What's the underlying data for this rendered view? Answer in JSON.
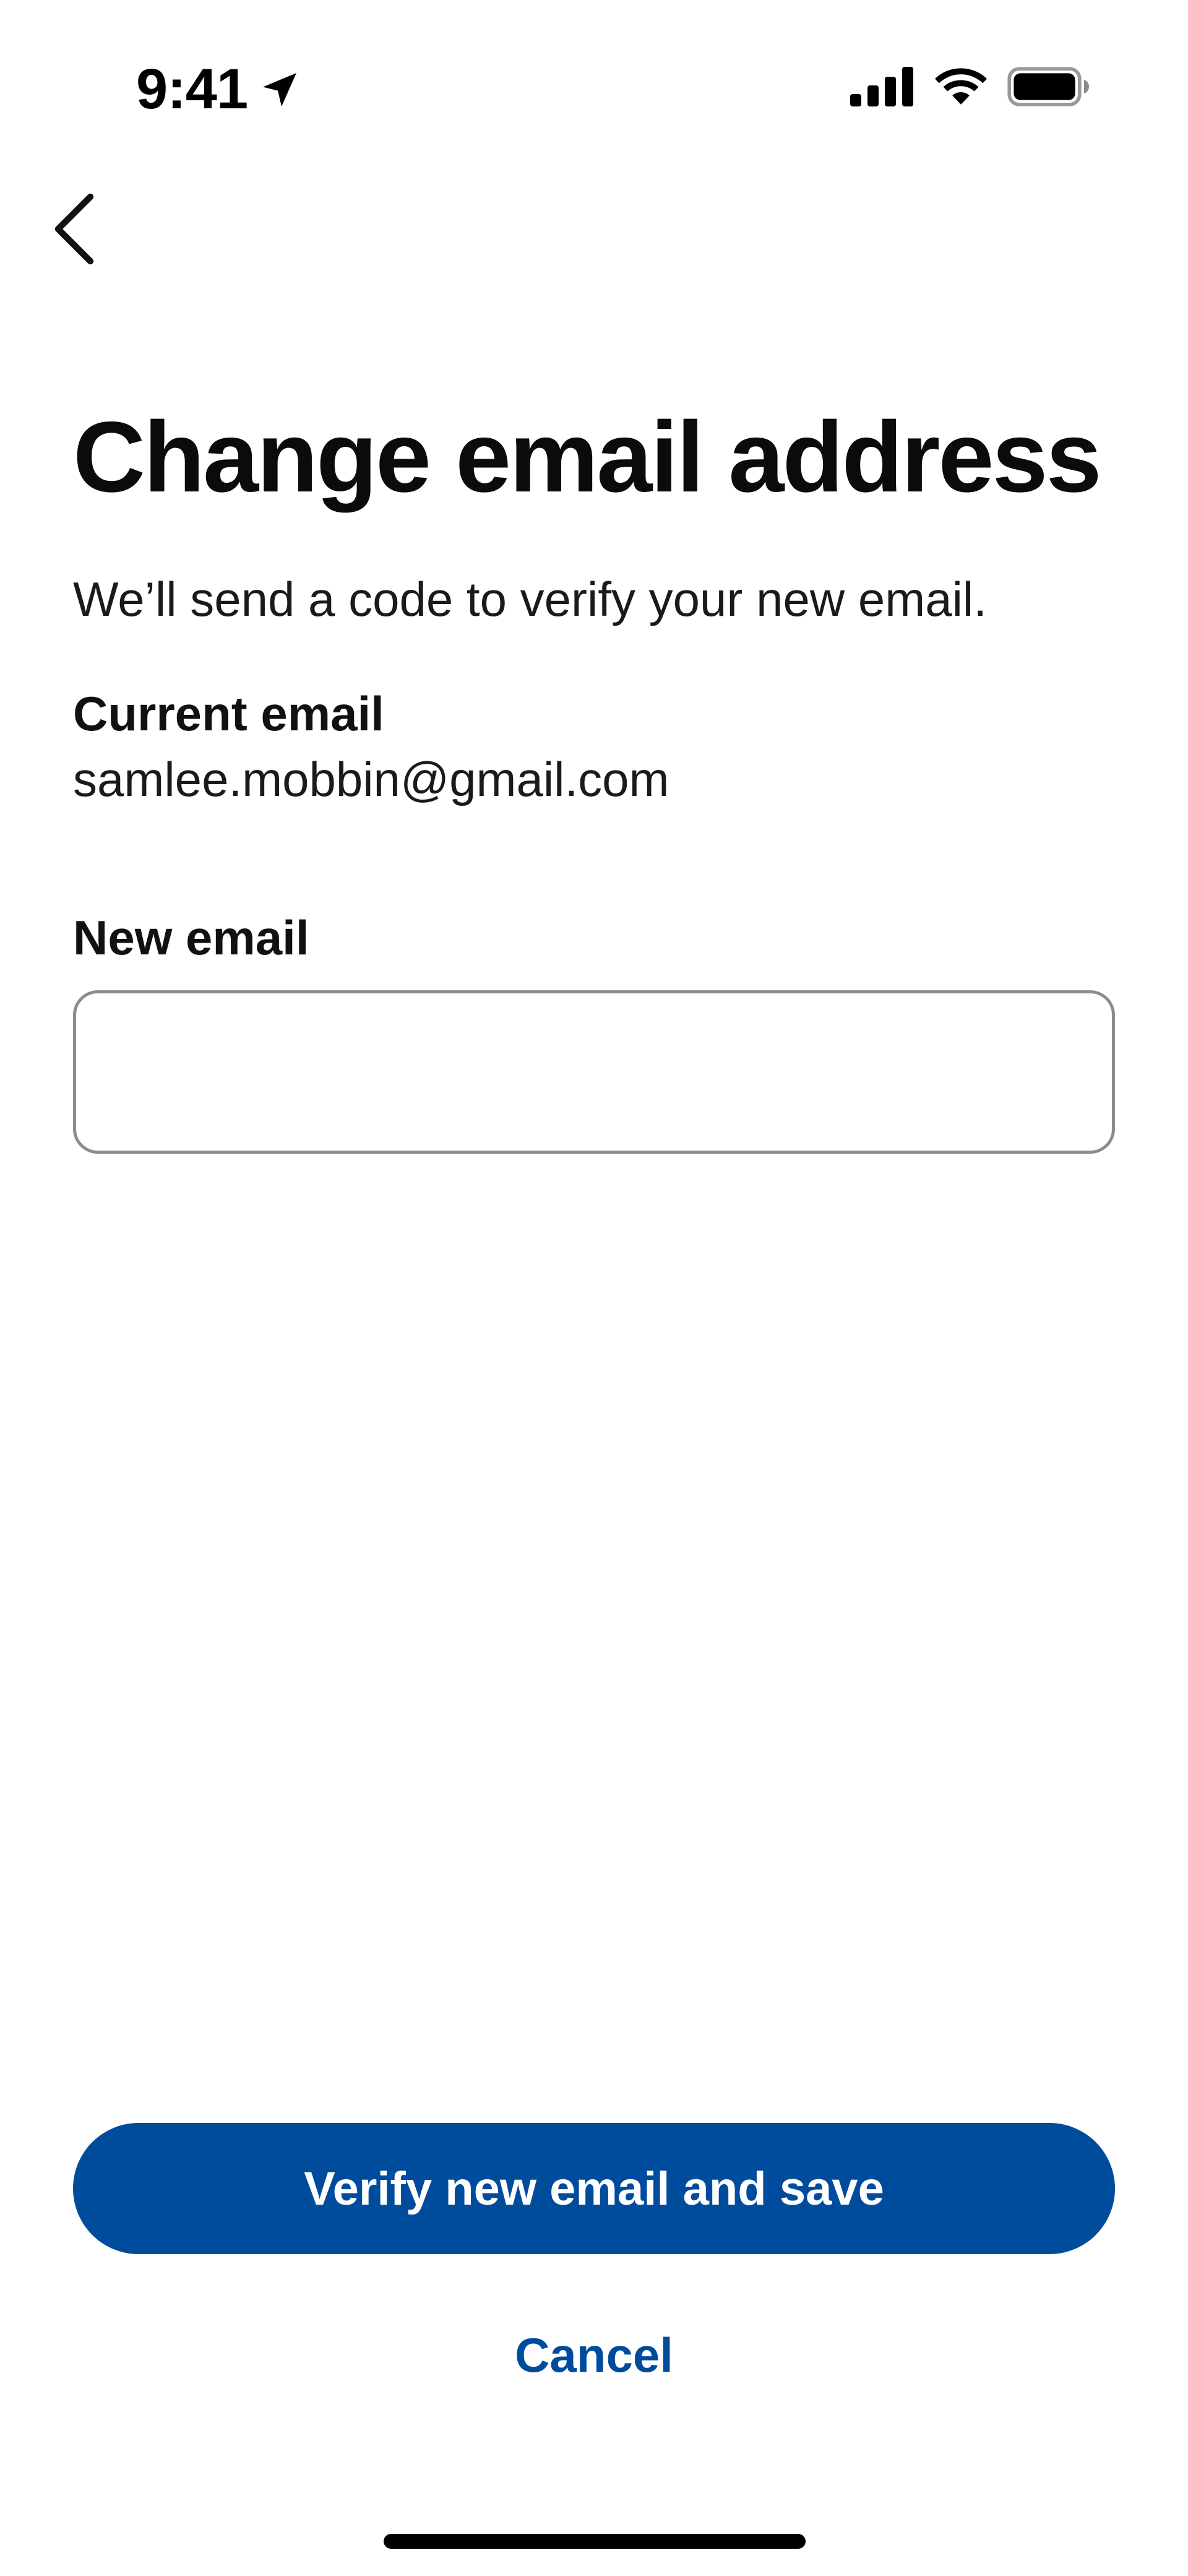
{
  "status_bar": {
    "time": "9:41",
    "icons": [
      "location-arrow-icon",
      "signal-bars-icon",
      "wifi-icon",
      "battery-icon"
    ]
  },
  "nav": {
    "back_icon": "chevron-left-icon"
  },
  "page": {
    "title": "Change email address",
    "subtitle": "We’ll send a code to verify your new email."
  },
  "current_email": {
    "label": "Current email",
    "value": "samlee.mobbin@gmail.com"
  },
  "new_email": {
    "label": "New email",
    "value": "",
    "placeholder": ""
  },
  "actions": {
    "primary_label": "Verify new email and save",
    "cancel_label": "Cancel"
  },
  "colors": {
    "accent": "#004c9c",
    "input_border": "#8c8c8c",
    "text": "#111111"
  }
}
